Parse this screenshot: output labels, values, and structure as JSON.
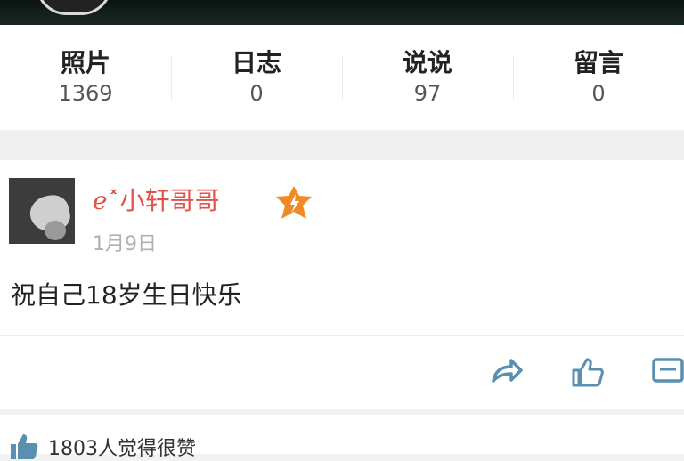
{
  "stats": [
    {
      "label": "照片",
      "count": "1369"
    },
    {
      "label": "日志",
      "count": "0"
    },
    {
      "label": "说说",
      "count": "97"
    },
    {
      "label": "留言",
      "count": "0"
    }
  ],
  "post": {
    "username": "ℯ˟小轩哥哥",
    "date": "1月9日",
    "text": "祝自己18岁生日快乐"
  },
  "likes": {
    "text": "1803人觉得很赞"
  },
  "colors": {
    "username": "#e2524a",
    "icons": "#5a8fb0",
    "badge": "#f08a24"
  },
  "icons": [
    "share-icon",
    "like-icon",
    "comment-icon",
    "thumbs-up-icon",
    "vip-badge-icon"
  ]
}
